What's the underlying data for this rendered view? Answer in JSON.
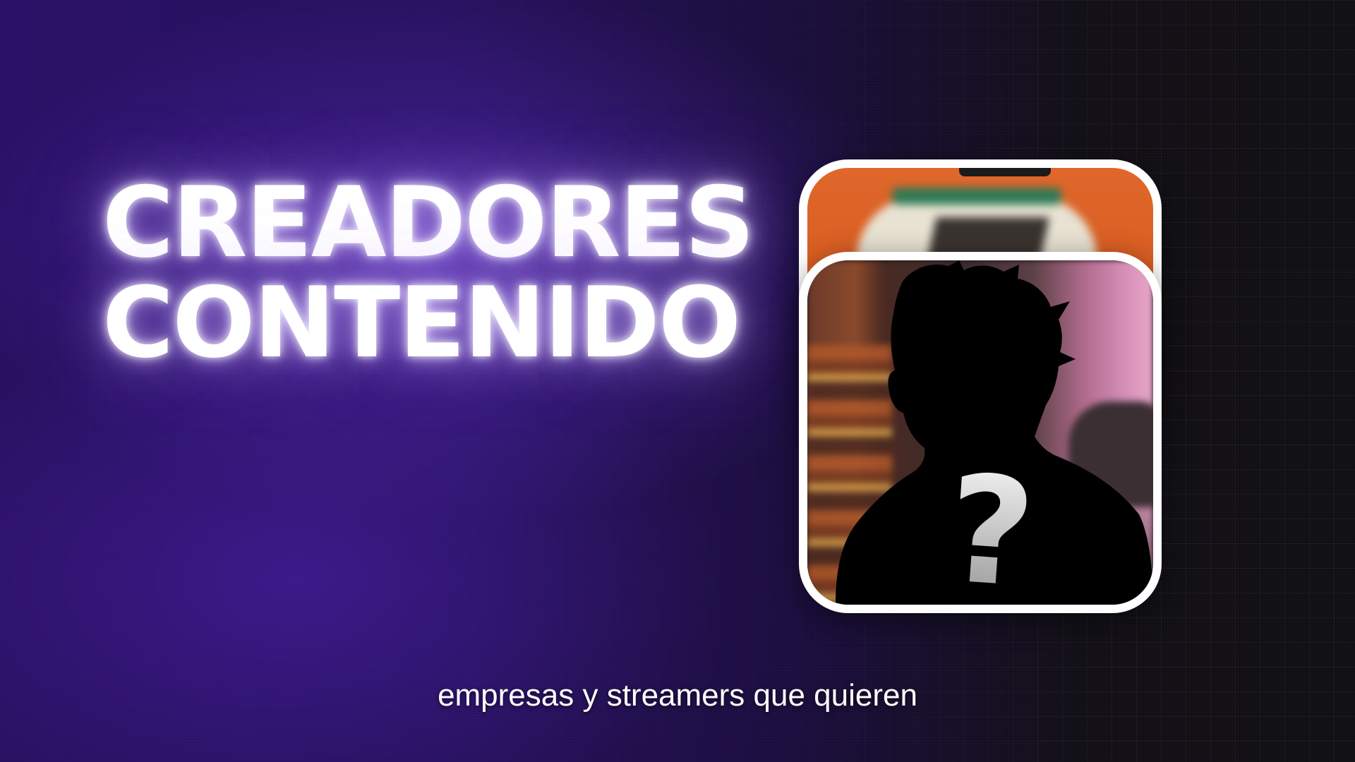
{
  "headline": {
    "line1": "CREADORES",
    "line2": "CONTENIDO"
  },
  "cards": {
    "front": {
      "question_mark": "?"
    }
  },
  "caption": "empresas y streamers que quieren",
  "colors": {
    "background_purple": "#2a1066",
    "background_dark": "#111014",
    "card_border": "#ffffff",
    "back_card_orange": "#e0672b",
    "text": "#ffffff"
  }
}
